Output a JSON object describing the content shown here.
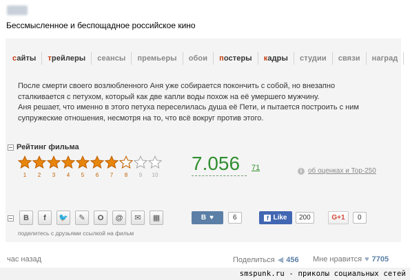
{
  "post": {
    "title": "Бессмысленное и беспощадное российское кино",
    "timestamp": "час назад"
  },
  "menu": {
    "items": [
      {
        "accent": "с",
        "rest": "айты",
        "dark": true
      },
      {
        "accent": "т",
        "rest": "рейлеры",
        "dark": true
      },
      {
        "accent": "",
        "rest": "сеансы",
        "dark": false
      },
      {
        "accent": "",
        "rest": "премьеры",
        "dark": false
      },
      {
        "accent": "",
        "rest": "обои",
        "dark": false
      },
      {
        "accent": "п",
        "rest": "остеры",
        "dark": true
      },
      {
        "accent": "к",
        "rest": "адры",
        "dark": true
      },
      {
        "accent": "",
        "rest": "студии",
        "dark": false
      },
      {
        "accent": "",
        "rest": "связи",
        "dark": false
      },
      {
        "accent": "",
        "rest": "наград",
        "dark": false
      }
    ]
  },
  "description": {
    "line1": "После смерти своего возлюбленного Аня уже собирается покончить с собой, но внезапно",
    "line2": "сталкивается с петухом, который как две капли воды похож на её умершего мужчину.",
    "line3": "Аня решает, что именно в этого петуха переселилась душа её Пети, и пытается построить с ним",
    "line4": "супружеские отношения, несмотря на то, что всё вокруг против этого."
  },
  "rating": {
    "heading": "Рейтинг фильма",
    "score": "7.056",
    "votes": "71",
    "filled_stars": 7.056,
    "max_stars": 10,
    "star_labels": [
      "1",
      "2",
      "3",
      "4",
      "5",
      "6",
      "7",
      "8",
      "9",
      "10"
    ],
    "about_link": "об оценках и Top-250",
    "star_color": "#e8860c",
    "star_off_color": "#d0d0d0"
  },
  "share": {
    "buttons": [
      {
        "name": "vk-share",
        "glyph": "В"
      },
      {
        "name": "facebook-share",
        "glyph": "f"
      },
      {
        "name": "twitter-share",
        "glyph": "🐦"
      },
      {
        "name": "livejournal-share",
        "glyph": "✎"
      },
      {
        "name": "odnoklassniki-share",
        "glyph": "О"
      },
      {
        "name": "moimir-share",
        "glyph": "@"
      },
      {
        "name": "email-share",
        "glyph": "✉"
      },
      {
        "name": "qr-share",
        "glyph": "▦"
      }
    ],
    "hint": "поделитесь с друзьями ссылкой на фильм",
    "vk_label": "В",
    "vk_count": "6",
    "fb_label": "Like",
    "fb_count": "200",
    "gplus_label": "G+1",
    "gplus_count": "0"
  },
  "footer": {
    "share_label": "Поделиться",
    "share_count": "456",
    "like_label": "Мне нравится",
    "like_count": "7705"
  },
  "watermark": "smspunk.ru - приколы социальных сетей"
}
